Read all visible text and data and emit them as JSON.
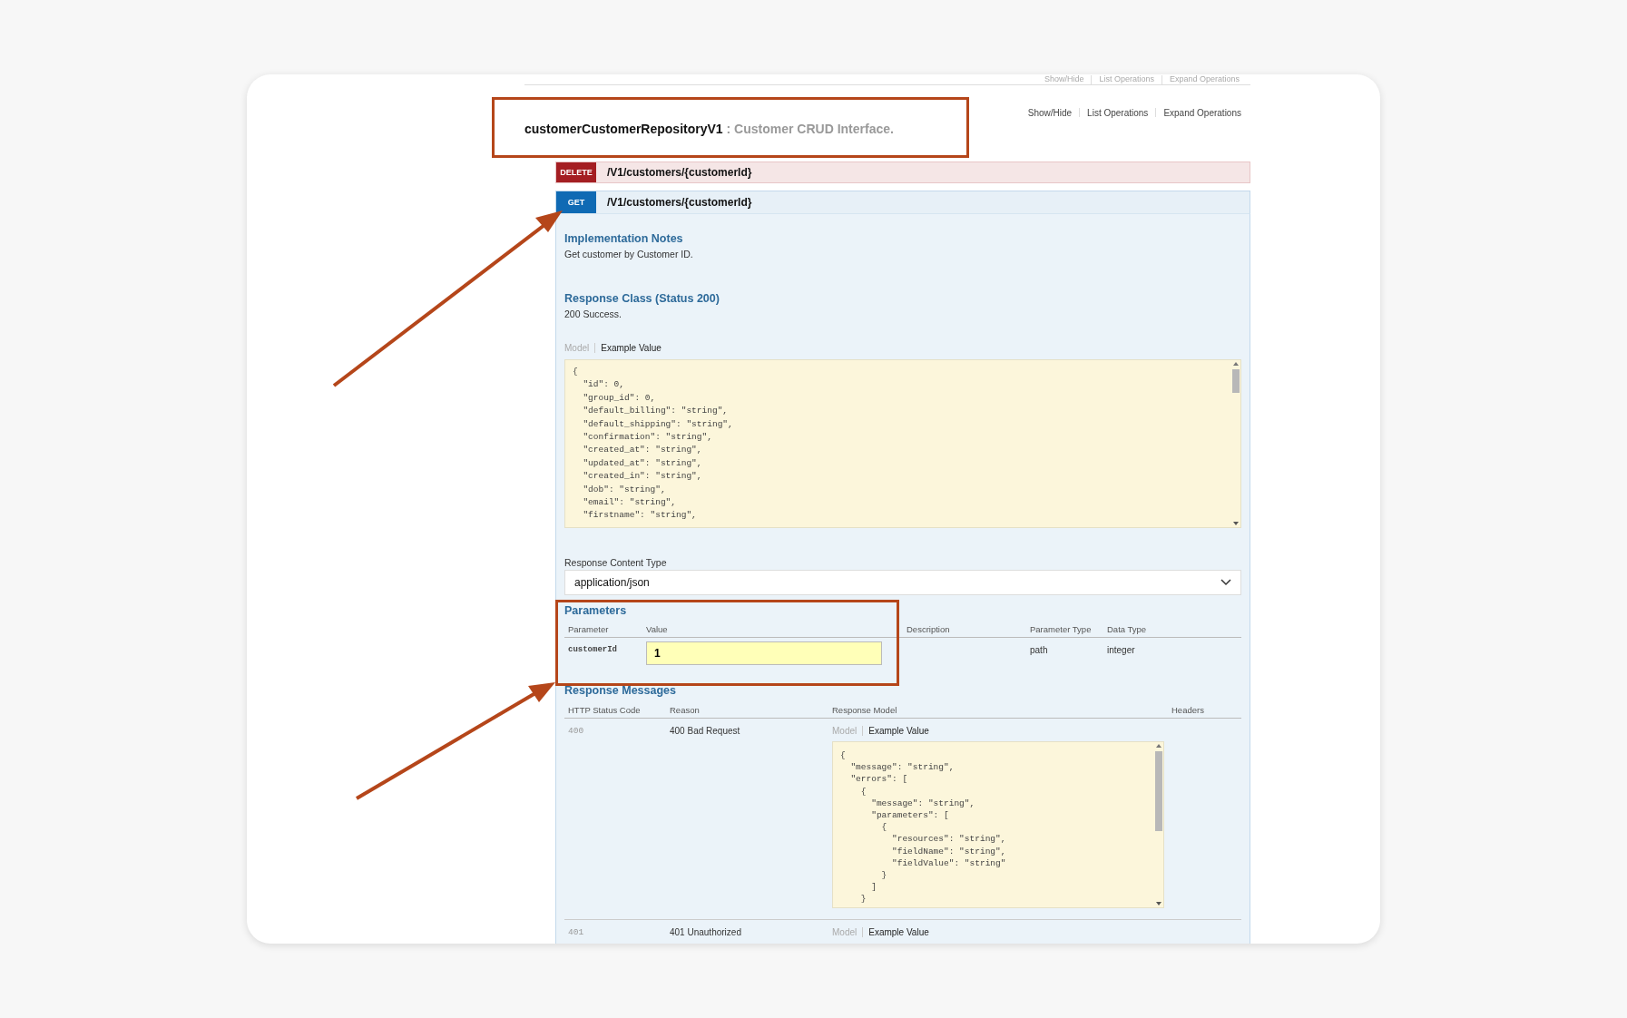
{
  "previous_section_links": [
    "Show/Hide",
    "List Operations",
    "Expand Operations"
  ],
  "resource": {
    "name": "customerCustomerRepositoryV1",
    "description": ": Customer CRUD Interface.",
    "links": [
      "Show/Hide",
      "List Operations",
      "Expand Operations"
    ]
  },
  "operations": [
    {
      "method": "DELETE",
      "path": "/V1/customers/{customerId}",
      "expanded": false
    },
    {
      "method": "GET",
      "path": "/V1/customers/{customerId}",
      "expanded": true
    }
  ],
  "details": {
    "implementation_notes": {
      "heading": "Implementation Notes",
      "text": "Get customer by Customer ID."
    },
    "response_class": {
      "heading": "Response Class (Status 200)",
      "text": "200 Success.",
      "tabs": [
        {
          "label": "Model",
          "selected": false
        },
        {
          "label": "Example Value",
          "selected": true
        }
      ],
      "code_lines": [
        "{",
        "  \"id\": 0,",
        "  \"group_id\": 0,",
        "  \"default_billing\": \"string\",",
        "  \"default_shipping\": \"string\",",
        "  \"confirmation\": \"string\",",
        "  \"created_at\": \"string\",",
        "  \"updated_at\": \"string\",",
        "  \"created_in\": \"string\",",
        "  \"dob\": \"string\",",
        "  \"email\": \"string\",",
        "  \"firstname\": \"string\","
      ]
    },
    "content_type": {
      "label": "Response Content Type",
      "value": "application/json"
    },
    "parameters": {
      "heading": "Parameters",
      "columns": [
        "Parameter",
        "Value",
        "Description",
        "Parameter Type",
        "Data Type"
      ],
      "rows": [
        {
          "parameter": "customerId",
          "value": "1",
          "parameter_type": "path",
          "data_type": "integer"
        }
      ]
    },
    "response_messages": {
      "heading": "Response Messages",
      "columns": [
        "HTTP Status Code",
        "Reason",
        "Response Model",
        "Headers"
      ],
      "rows": [
        {
          "code": "400",
          "reason": "400 Bad Request",
          "tabs": [
            {
              "label": "Model",
              "selected": false
            },
            {
              "label": "Example Value",
              "selected": true
            }
          ],
          "code_lines": [
            "{",
            "  \"message\": \"string\",",
            "  \"errors\": [",
            "    {",
            "      \"message\": \"string\",",
            "      \"parameters\": [",
            "        {",
            "          \"resources\": \"string\",",
            "          \"fieldName\": \"string\",",
            "          \"fieldValue\": \"string\"",
            "        }",
            "      ]",
            "    }"
          ]
        },
        {
          "code": "401",
          "reason": "401 Unauthorized",
          "tabs": [
            {
              "label": "Model",
              "selected": false
            },
            {
              "label": "Example Value",
              "selected": true
            }
          ],
          "code_lines": []
        }
      ]
    }
  }
}
